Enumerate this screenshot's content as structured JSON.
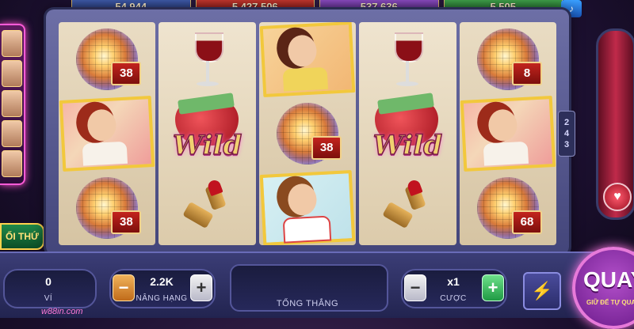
{
  "top_meters": [
    "54,944",
    "5,427,506",
    "537,636",
    "5,505"
  ],
  "side_tag": "ỐI THỨ",
  "ways_count": [
    "2",
    "4",
    "3"
  ],
  "reels": [
    [
      {
        "symbol": "disco-ball",
        "value": "38"
      },
      {
        "symbol": "pinup-sailor"
      },
      {
        "symbol": "disco-ball",
        "value": "38"
      }
    ],
    [
      {
        "symbol": "wine-glass"
      },
      {
        "symbol": "wild",
        "text": "Wild"
      },
      {
        "symbol": "lipstick"
      }
    ],
    [
      {
        "symbol": "pinup-microphone"
      },
      {
        "symbol": "disco-ball",
        "value": "38"
      },
      {
        "symbol": "pinup-nurse"
      }
    ],
    [
      {
        "symbol": "wine-glass"
      },
      {
        "symbol": "wild",
        "text": "Wild"
      },
      {
        "symbol": "lipstick"
      }
    ],
    [
      {
        "symbol": "disco-ball",
        "value": "8"
      },
      {
        "symbol": "pinup-sailor"
      },
      {
        "symbol": "disco-ball",
        "value": "68"
      }
    ]
  ],
  "controls": {
    "wallet": {
      "value": "0",
      "label": "VÍ"
    },
    "level": {
      "value": "2.2K",
      "label": "NÂNG HẠNG",
      "minus": "−",
      "plus": "+"
    },
    "total_win": {
      "label": "TỔNG THẮNG"
    },
    "bet": {
      "value": "x1",
      "label": "CƯỢC",
      "minus": "−",
      "plus": "+"
    },
    "turbo_icon": "lightning-icon",
    "spin": {
      "label": "QUAY",
      "sub": "GIỮ ĐỂ TỰ QUAY"
    }
  },
  "site": "w88in.com",
  "colors": {
    "accent": "#e77ad9",
    "badge": "#c3241e",
    "frame": "#43457a"
  }
}
